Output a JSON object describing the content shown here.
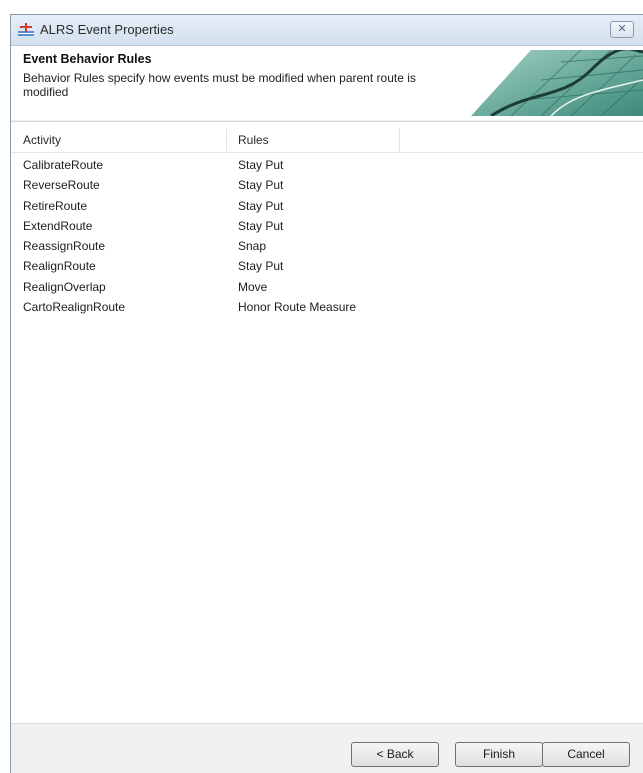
{
  "window": {
    "title": "ALRS Event Properties"
  },
  "header": {
    "title": "Event Behavior Rules",
    "description": "Behavior Rules specify how events must be modified when parent route is modified"
  },
  "table": {
    "columns": [
      "Activity",
      "Rules"
    ],
    "rows": [
      {
        "activity": "CalibrateRoute",
        "rule": "Stay Put"
      },
      {
        "activity": "ReverseRoute",
        "rule": "Stay Put"
      },
      {
        "activity": "RetireRoute",
        "rule": "Stay Put"
      },
      {
        "activity": "ExtendRoute",
        "rule": "Stay Put"
      },
      {
        "activity": "ReassignRoute",
        "rule": "Snap"
      },
      {
        "activity": "RealignRoute",
        "rule": "Stay Put"
      },
      {
        "activity": "RealignOverlap",
        "rule": "Move"
      },
      {
        "activity": "CartoRealignRoute",
        "rule": "Honor Route Measure"
      }
    ]
  },
  "buttons": {
    "back": "< Back",
    "finish": "Finish",
    "cancel": "Cancel"
  },
  "icons": {
    "app": "route-event-icon",
    "close": "close-icon",
    "banner": "map-banner-image"
  }
}
